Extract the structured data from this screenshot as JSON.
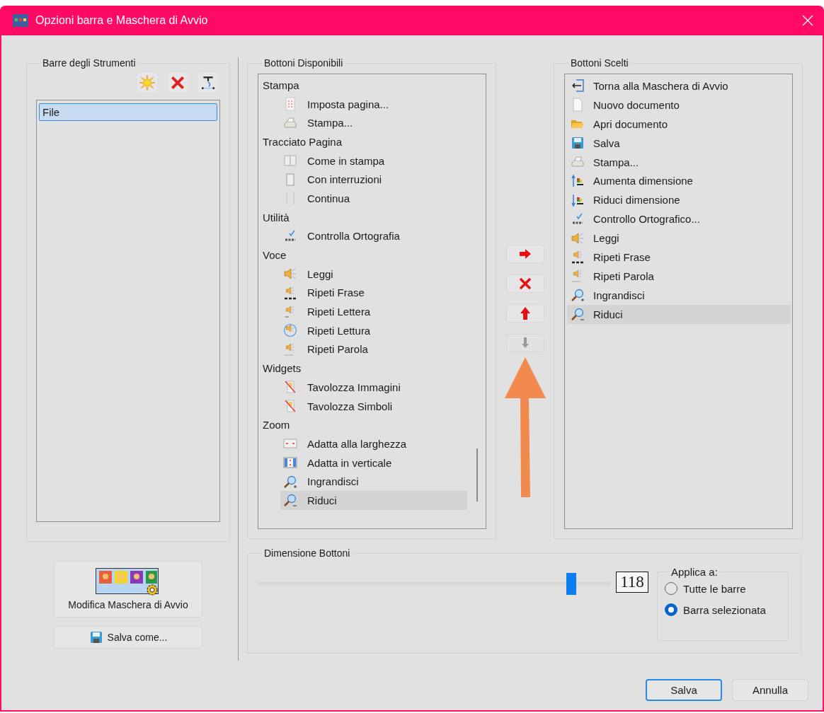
{
  "window": {
    "title": "Opzioni barra e Maschera di Avvio"
  },
  "toolbars": {
    "title": "Barre degli Strumenti",
    "items": [
      {
        "label": "File",
        "selected": true
      }
    ]
  },
  "available": {
    "title": "Bottoni Disponibili",
    "groups": [
      {
        "label": "Stampa",
        "children": [
          {
            "label": "Imposta pagina...",
            "selected": false
          },
          {
            "label": "Stampa...",
            "selected": false
          }
        ]
      },
      {
        "label": "Tracciato Pagina",
        "children": [
          {
            "label": "Come in stampa",
            "selected": false
          },
          {
            "label": "Con interruzioni",
            "selected": false
          },
          {
            "label": "Continua",
            "selected": false
          }
        ]
      },
      {
        "label": "Utilità",
        "children": [
          {
            "label": "Controlla Ortografia",
            "selected": false
          }
        ]
      },
      {
        "label": "Voce",
        "children": [
          {
            "label": "Leggi",
            "selected": false
          },
          {
            "label": "Ripeti Frase",
            "selected": false
          },
          {
            "label": "Ripeti Lettera",
            "selected": false
          },
          {
            "label": "Ripeti Lettura",
            "selected": false
          },
          {
            "label": "Ripeti Parola",
            "selected": false
          }
        ]
      },
      {
        "label": "Widgets",
        "children": [
          {
            "label": "Tavolozza Immagini",
            "selected": false
          },
          {
            "label": "Tavolozza Simboli",
            "selected": false
          }
        ]
      },
      {
        "label": "Zoom",
        "children": [
          {
            "label": "Adatta alla larghezza",
            "selected": false
          },
          {
            "label": "Adatta in verticale",
            "selected": false
          },
          {
            "label": "Ingrandisci",
            "selected": false
          },
          {
            "label": "Riduci",
            "selected": true
          }
        ]
      }
    ]
  },
  "move_buttons": [
    {
      "disabled": false
    },
    {
      "disabled": false
    },
    {
      "disabled": false
    },
    {
      "disabled": true
    }
  ],
  "chosen": {
    "title": "Bottoni Scelti",
    "items": [
      {
        "label": "Torna alla Maschera di Avvio",
        "selected": false
      },
      {
        "label": "Nuovo documento",
        "selected": false
      },
      {
        "label": "Apri documento",
        "selected": false
      },
      {
        "label": "Salva",
        "selected": false
      },
      {
        "label": "Stampa...",
        "selected": false
      },
      {
        "label": "Aumenta dimensione",
        "selected": false
      },
      {
        "label": "Riduci dimensione",
        "selected": false
      },
      {
        "label": "Controllo Ortografico...",
        "selected": false
      },
      {
        "label": "Leggi",
        "selected": false
      },
      {
        "label": "Ripeti Frase",
        "selected": false
      },
      {
        "label": "Ripeti Parola",
        "selected": false
      },
      {
        "label": "Ingrandisci",
        "selected": false
      },
      {
        "label": "Riduci",
        "selected": true
      }
    ]
  },
  "start_mask_button": "Modifica Maschera di Avvio",
  "save_as_button": "Salva come...",
  "button_size": {
    "title": "Dimensione Bottoni",
    "level": 0.89,
    "value": "118",
    "apply_to": {
      "title": "Applica a:",
      "options": [
        {
          "label": "Tutte le barre",
          "selected": false
        },
        {
          "label": "Barra selezionata",
          "selected": true
        }
      ]
    }
  },
  "footer_buttons": [
    {
      "label": "Salva",
      "default": true
    },
    {
      "label": "Annulla",
      "default": false
    }
  ]
}
